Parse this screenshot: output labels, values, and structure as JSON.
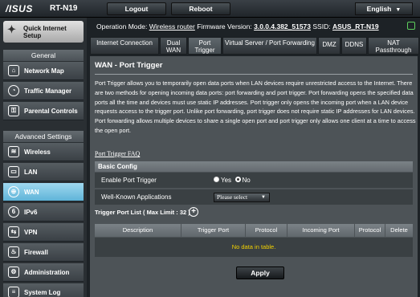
{
  "top": {
    "logo": "/ISUS",
    "model": "RT-N19",
    "logout": "Logout",
    "reboot": "Reboot",
    "language": "English"
  },
  "sidebar": {
    "quick_setup": "Quick Internet Setup",
    "general_header": "General",
    "general_items": [
      {
        "label": "Network Map",
        "icon": "network-map-icon"
      },
      {
        "label": "Traffic Manager",
        "icon": "traffic-icon"
      },
      {
        "label": "Parental Controls",
        "icon": "lock-icon"
      }
    ],
    "advanced_header": "Advanced Settings",
    "advanced_items": [
      {
        "label": "Wireless",
        "icon": "wifi-icon"
      },
      {
        "label": "LAN",
        "icon": "lan-icon"
      },
      {
        "label": "WAN",
        "icon": "globe-icon"
      },
      {
        "label": "IPv6",
        "icon": "ipv6-icon"
      },
      {
        "label": "VPN",
        "icon": "vpn-icon"
      },
      {
        "label": "Firewall",
        "icon": "firewall-icon"
      },
      {
        "label": "Administration",
        "icon": "gear-icon"
      },
      {
        "label": "System Log",
        "icon": "log-icon"
      }
    ],
    "active": "WAN"
  },
  "status": {
    "operation_mode_label": "Operation Mode:",
    "operation_mode": "Wireless router",
    "firmware_label": "Firmware Version:",
    "firmware": "3.0.0.4.382_51573",
    "ssid_label": "SSID:",
    "ssid": "ASUS_RT-N19"
  },
  "tabs": [
    {
      "label": "Internet Connection"
    },
    {
      "label": "Dual WAN"
    },
    {
      "label": "Port Trigger",
      "active": true
    },
    {
      "label": "Virtual Server / Port Forwarding"
    },
    {
      "label": "DMZ"
    },
    {
      "label": "DDNS"
    },
    {
      "label": "NAT Passthrough"
    }
  ],
  "page": {
    "title": "WAN - Port Trigger",
    "description": "Port Trigger allows you to temporarily open data ports when LAN devices require unrestricted access to the Internet. There are two methods for opening incoming data ports: port forwarding and port trigger. Port forwarding opens the specified data ports all the time and devices must use static IP addresses. Port trigger only opens the incoming port when a LAN device requests access to the trigger port. Unlike port forwarding, port trigger does not require static IP addresses for LAN devices. Port forwarding allows multiple devices to share a single open port and port trigger only allows one client at a time to access the open port.",
    "faq_link": "Port Trigger FAQ"
  },
  "basic_config": {
    "header": "Basic Config",
    "enable_label": "Enable Port Trigger",
    "yes": "Yes",
    "no": "No",
    "enable_value": "No",
    "wka_label": "Well-Known Applications",
    "wka_value": "Please select"
  },
  "trigger_list": {
    "title": "Trigger Port List ( Max Limit : 32 )",
    "columns": [
      "Description",
      "Trigger Port",
      "Protocol",
      "Incoming Port",
      "Protocol",
      "Delete"
    ],
    "empty_text": "No data in table."
  },
  "apply": "Apply"
}
